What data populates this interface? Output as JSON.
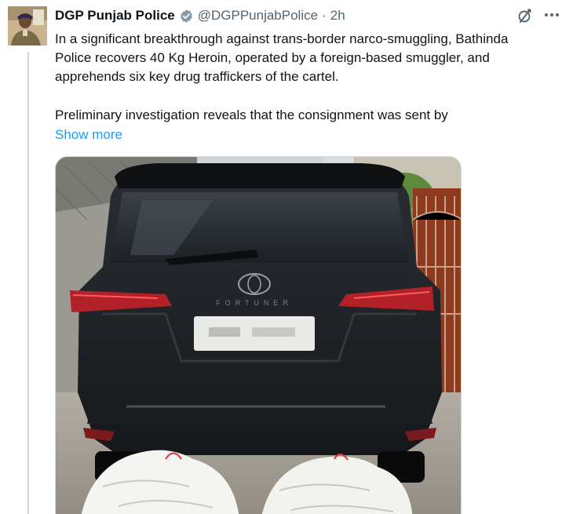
{
  "author": {
    "display_name": "DGP Punjab Police",
    "handle": "@DGPPunjabPolice",
    "separator": "·",
    "time": "2h",
    "avatar_icon": "profile-photo-uniformed-officer",
    "verified_icon": "verified-badge-icon"
  },
  "tweet": {
    "paragraph1": "In a significant breakthrough against trans-border narco-smuggling, Bathinda Police recovers 40 Kg Heroin, operated by a foreign-based smuggler, and apprehends six key drug traffickers of the cartel.",
    "paragraph2": "Preliminary investigation reveals that the consignment was sent by",
    "show_more": "Show more"
  },
  "media": {
    "description_icon": "photo-of-black-suv-rear-with-seized-sacks",
    "vehicle_badge": "FORTUNER"
  },
  "icons": {
    "grok": "grok-icon",
    "more": "more-options-icon"
  },
  "colors": {
    "link": "#1d9bf0",
    "secondary_text": "#536471",
    "verified": "#829aab"
  }
}
